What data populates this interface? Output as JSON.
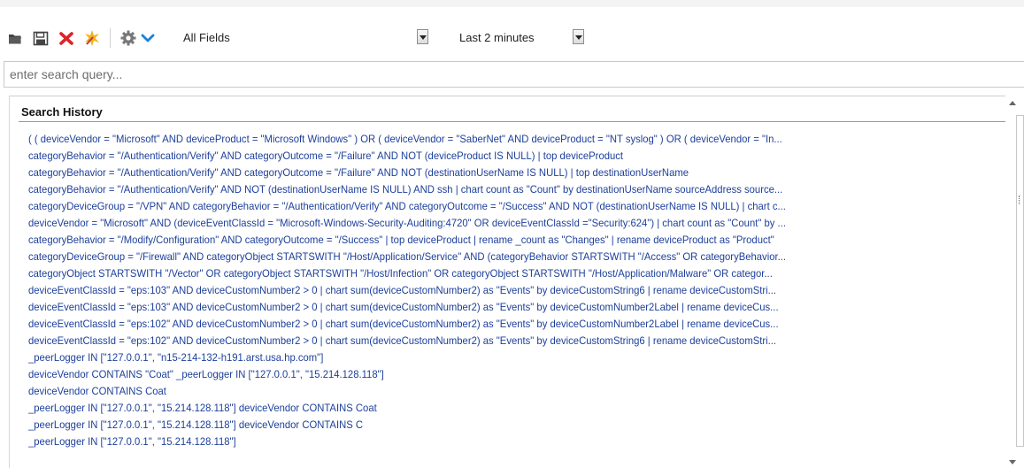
{
  "toolbar": {
    "icons": [
      "open-folder-icon",
      "save-icon",
      "delete-icon",
      "clear-icon",
      "gear-icon",
      "chevron-down-icon"
    ],
    "field_select": {
      "value": "All Fields"
    },
    "time_select": {
      "value": "Last 2 minutes"
    }
  },
  "search": {
    "placeholder": "enter search query..."
  },
  "history": {
    "title": "Search History",
    "items": [
      "( ( deviceVendor = \"Microsoft\" AND deviceProduct = \"Microsoft Windows\" ) OR ( deviceVendor = \"SaberNet\" AND deviceProduct = \"NT syslog\" ) OR ( deviceVendor = \"In...",
      "categoryBehavior = \"/Authentication/Verify\" AND categoryOutcome = \"/Failure\" AND NOT (deviceProduct IS NULL) | top deviceProduct",
      "categoryBehavior = \"/Authentication/Verify\" AND categoryOutcome = \"/Failure\" AND NOT (destinationUserName IS NULL) | top destinationUserName",
      "categoryBehavior = \"/Authentication/Verify\" AND NOT (destinationUserName IS NULL) AND ssh | chart count as \"Count\" by destinationUserName sourceAddress source...",
      "categoryDeviceGroup = \"/VPN\" AND categoryBehavior = \"/Authentication/Verify\" AND categoryOutcome = \"/Success\" AND NOT (destinationUserName IS NULL) | chart c...",
      "deviceVendor = \"Microsoft\" AND (deviceEventClassId = \"Microsoft-Windows-Security-Auditing:4720\" OR deviceEventClassId =\"Security:624\") | chart count as \"Count\" by ...",
      "categoryBehavior = \"/Modify/Configuration\" AND categoryOutcome = \"/Success\" | top deviceProduct | rename _count as \"Changes\" | rename deviceProduct as \"Product\"",
      "categoryDeviceGroup = \"/Firewall\" AND categoryObject STARTSWITH \"/Host/Application/Service\" AND (categoryBehavior STARTSWITH \"/Access\" OR categoryBehavior...",
      "categoryObject STARTSWITH \"/Vector\" OR categoryObject STARTSWITH \"/Host/Infection\" OR categoryObject STARTSWITH \"/Host/Application/Malware\" OR categor...",
      "deviceEventClassId = \"eps:103\" AND deviceCustomNumber2 > 0 | chart sum(deviceCustomNumber2) as \"Events\" by deviceCustomString6 | rename deviceCustomStri...",
      "deviceEventClassId = \"eps:103\" AND deviceCustomNumber2 > 0 | chart sum(deviceCustomNumber2) as \"Events\" by deviceCustomNumber2Label | rename deviceCus...",
      "deviceEventClassId = \"eps:102\" AND deviceCustomNumber2 > 0 | chart sum(deviceCustomNumber2) as \"Events\" by deviceCustomNumber2Label | rename deviceCus...",
      "deviceEventClassId = \"eps:102\" AND deviceCustomNumber2 > 0 | chart sum(deviceCustomNumber2) as \"Events\" by deviceCustomString6 | rename deviceCustomStri...",
      "_peerLogger IN [\"127.0.0.1\", \"n15-214-132-h191.arst.usa.hp.com\"]",
      "deviceVendor CONTAINS \"Coat\" _peerLogger IN [\"127.0.0.1\", \"15.214.128.118\"]",
      "deviceVendor CONTAINS Coat",
      "_peerLogger IN [\"127.0.0.1\", \"15.214.128.118\"] deviceVendor CONTAINS Coat",
      "_peerLogger IN [\"127.0.0.1\", \"15.214.128.118\"] deviceVendor CONTAINS C",
      "_peerLogger IN [\"127.0.0.1\", \"15.214.128.118\"]"
    ]
  }
}
